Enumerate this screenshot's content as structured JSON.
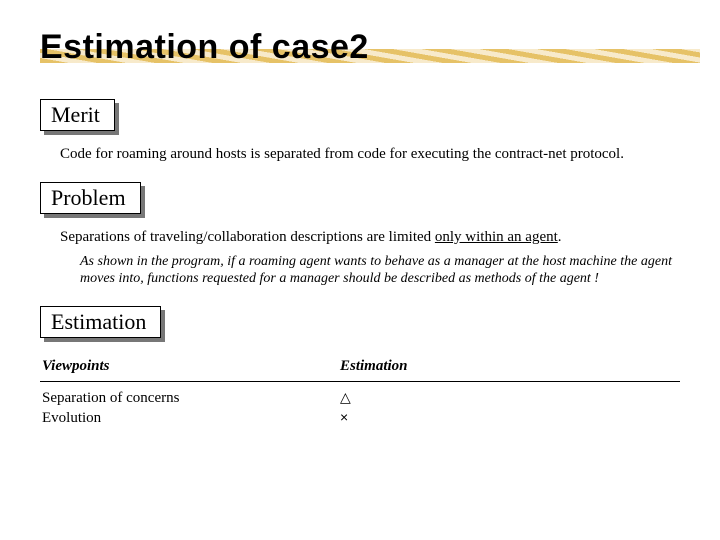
{
  "title": "Estimation of case2",
  "sections": {
    "merit": {
      "label": "Merit",
      "text": "Code for roaming around hosts is separated from code for executing the contract-net protocol."
    },
    "problem": {
      "label": "Problem",
      "text_prefix": "Separations of traveling/collaboration descriptions are limited ",
      "text_underlined": "only within an agent",
      "text_suffix": ".",
      "sub": "As shown in the program, if a roaming agent wants to behave as a manager at the host machine the agent moves into, functions requested for a manager should be described as methods of the agent !"
    },
    "estimation": {
      "label": "Estimation",
      "headers": {
        "viewpoints": "Viewpoints",
        "estimation": "Estimation"
      },
      "rows": [
        {
          "label": "Separation of concerns",
          "value": "△"
        },
        {
          "label": "Evolution",
          "value": "×"
        }
      ]
    }
  }
}
